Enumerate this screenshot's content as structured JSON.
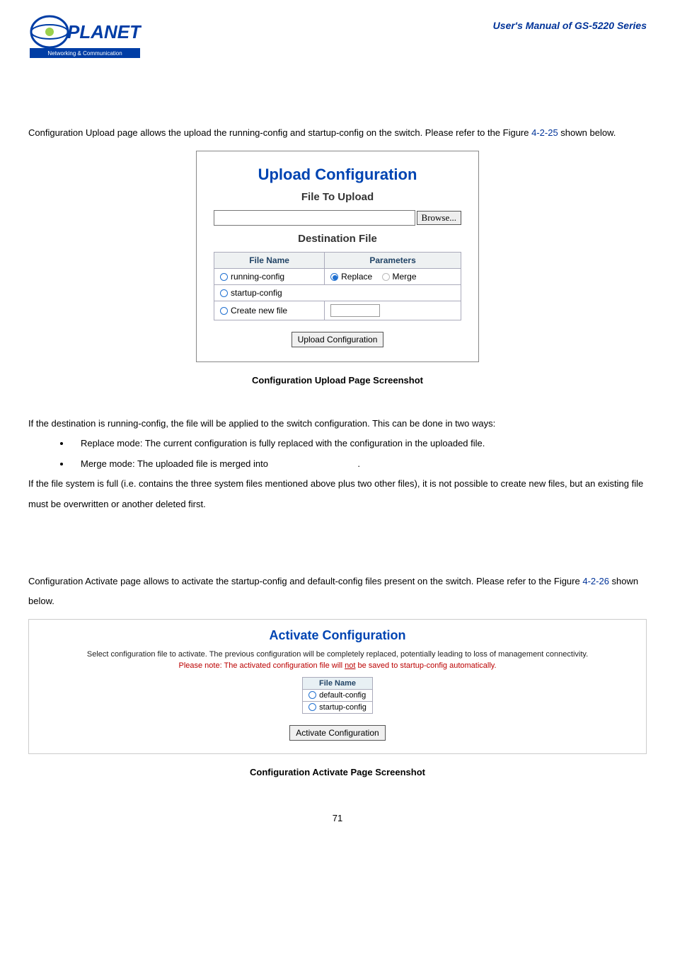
{
  "header": {
    "manual_title": "User's Manual of GS-5220 Series"
  },
  "upload_section": {
    "intro_a": "Configuration Upload page allows the upload the running-config and startup-config on the switch. Please refer to the Figure ",
    "figure_ref": "4-2-25",
    "intro_b": " shown below.",
    "sc_title": "Upload Configuration",
    "file_to_upload": "File To Upload",
    "browse_label": "Browse...",
    "dest_file": "Destination File",
    "th_file_name": "File Name",
    "th_parameters": "Parameters",
    "opt_running": "running-config",
    "opt_replace": "Replace",
    "opt_merge": "Merge",
    "opt_startup": "startup-config",
    "opt_create": "Create new file",
    "upload_btn": "Upload Configuration",
    "caption_a": "Configuration Upload Page Screenshot",
    "desc_1": "If the destination is running-config, the file will be applied to the switch configuration. This can be done in two ways:",
    "bullet_1": "Replace mode: The current configuration is fully replaced with the configuration in the uploaded file.",
    "bullet_2a": "Merge mode: The uploaded file is merged into ",
    "bullet_2b": ".",
    "desc_2": "If the file system is full (i.e. contains the three system files mentioned above plus two other files), it is not possible to create new files, but an existing file must be overwritten or another deleted first."
  },
  "activate_section": {
    "intro_a": "Configuration Activate page allows to activate the startup-config and default-config files present on the switch. Please refer to the Figure ",
    "figure_ref": "4-2-26",
    "intro_b": " shown below.",
    "sc_title": "Activate Configuration",
    "desc_line": "Select configuration file to activate. The previous configuration will be completely replaced, potentially leading to loss of management connectivity.",
    "warn_a": "Please note: The activated configuration file will ",
    "warn_not": "not",
    "warn_b": " be saved to startup-config automatically.",
    "th_file_name": "File Name",
    "opt_default": "default-config",
    "opt_startup": "startup-config",
    "activate_btn": "Activate Configuration",
    "caption_b": "Configuration Activate Page Screenshot"
  },
  "page_number": "71"
}
